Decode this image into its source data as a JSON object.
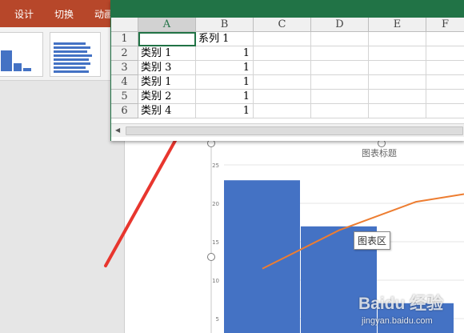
{
  "ribbon": {
    "tabs": [
      "设计",
      "切换",
      "动画"
    ]
  },
  "excel": {
    "columns": [
      "A",
      "B",
      "C",
      "D",
      "E",
      "F"
    ],
    "rows": [
      {
        "num": "1",
        "a": "",
        "b": "系列 1"
      },
      {
        "num": "2",
        "a": "类别 1",
        "b": "1"
      },
      {
        "num": "3",
        "a": "类别 3",
        "b": "1"
      },
      {
        "num": "4",
        "a": "类别 1",
        "b": "1"
      },
      {
        "num": "5",
        "a": "类别 2",
        "b": "1"
      },
      {
        "num": "6",
        "a": "类别 4",
        "b": "1"
      }
    ],
    "selected_cell": "A1"
  },
  "chart": {
    "title": "图表标题",
    "tooltip": "图表区",
    "bar_color": "#4472c4",
    "line_color": "#ed7d31",
    "y_ticks": [
      "25",
      "20",
      "15",
      "10",
      "5"
    ]
  },
  "chart_data": {
    "type": "bar",
    "title": "图表标题",
    "ylim": [
      0,
      25
    ],
    "bars": [
      23,
      17,
      7
    ],
    "line_visible": [
      11.5,
      16.5,
      20.2,
      21.2
    ]
  },
  "watermark": {
    "logo": "Baidu 经验",
    "url": "jingyan.baidu.com"
  },
  "arrow": {
    "color": "#e8362e"
  }
}
